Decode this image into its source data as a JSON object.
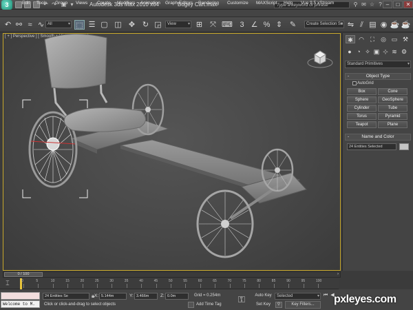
{
  "titlebar": {
    "app_title": "Autodesk 3ds Max  2010 x64",
    "file_title": "Bogey Cart.max",
    "help_placeholder": "Type a keyword or phrase",
    "logo_letter": "3"
  },
  "menu": [
    "Edit",
    "Tools",
    "Group",
    "Views",
    "Create",
    "Modifiers",
    "Animation",
    "Graph Editors",
    "Rendering",
    "Customize",
    "MAXScript",
    "Help",
    "Vue 9.5 xStream"
  ],
  "toolbar": {
    "filter_value": "All",
    "refcoord_value": "View",
    "selection_set_placeholder": "Create Selection Se"
  },
  "viewport": {
    "label": "[ + ] Perspective ] [ Smooth + Highlight + Hid ]"
  },
  "command_panel": {
    "primitives_dropdown": "Standard Primitives",
    "object_type_title": "Object Type",
    "autogrid_label": "AutoGrid",
    "object_buttons": [
      "Box",
      "Cone",
      "Sphere",
      "GeoSphere",
      "Cylinder",
      "Tube",
      "Torus",
      "Pyramid",
      "Teapot",
      "Plane"
    ],
    "name_color_title": "Name and Color",
    "name_value": "24 Entities Selected",
    "rollout_sign": "-"
  },
  "timeline": {
    "slider_text": "0 / 100",
    "ticks": [
      "0",
      "5",
      "10",
      "15",
      "20",
      "25",
      "30",
      "35",
      "40",
      "45",
      "50",
      "55",
      "60",
      "65",
      "70",
      "75",
      "80",
      "85",
      "90",
      "95",
      "100"
    ]
  },
  "status": {
    "maxscript_text": "Welcome to M.",
    "selection_count": "24 Entities Se",
    "prompt": "Click or click-and-drag to select objects",
    "x_label": "X:",
    "x_value": "5.144m",
    "y_label": "Y:",
    "y_value": "3.466m",
    "z_label": "Z:",
    "z_value": "0.0m",
    "grid": "Grid = 0.254m",
    "add_time_tag": "Add Time Tag",
    "auto_key": "Auto Key",
    "set_key": "Set Key",
    "selected_value": "Selected",
    "key_filters": "Key Filters...",
    "watermark": "pxleyes.com"
  },
  "colors": {
    "viewport_border": "#c9a92a",
    "frame_marker": "#e8c43a",
    "maxscript_pink": "#f2dede"
  }
}
